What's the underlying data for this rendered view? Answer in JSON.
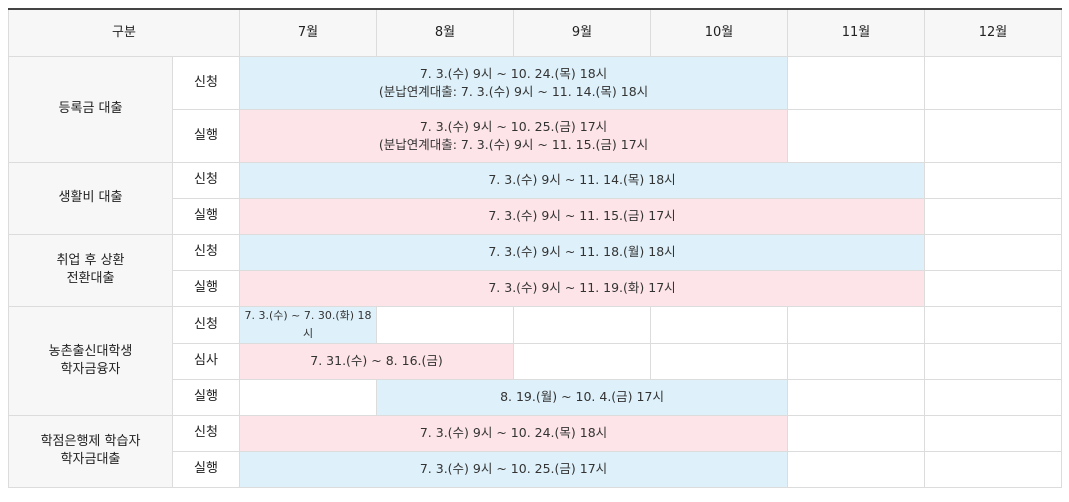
{
  "header": {
    "category": "구분",
    "months": [
      "7월",
      "8월",
      "9월",
      "10월",
      "11월",
      "12월"
    ]
  },
  "rows": {
    "tuition": {
      "category": "등록금 대출",
      "apply_label": "신청",
      "apply_line1": "7. 3.(수) 9시 ~ 10. 24.(목) 18시",
      "apply_line2": "(분납연계대출: 7. 3.(수) 9시 ~ 11. 14.(목) 18시",
      "exec_label": "실행",
      "exec_line1": "7. 3.(수) 9시 ~ 10. 25.(금) 17시",
      "exec_line2": "(분납연계대출: 7. 3.(수) 9시 ~ 11. 15.(금) 17시"
    },
    "living": {
      "category": "생활비 대출",
      "apply_label": "신청",
      "apply": "7. 3.(수) 9시 ~ 11. 14.(목) 18시",
      "exec_label": "실행",
      "exec": "7. 3.(수) 9시 ~ 11. 15.(금) 17시"
    },
    "employment": {
      "category_line1": "취업 후 상환",
      "category_line2": "전환대출",
      "apply_label": "신청",
      "apply": "7. 3.(수) 9시 ~ 11. 18.(월) 18시",
      "exec_label": "실행",
      "exec": "7. 3.(수) 9시 ~ 11. 19.(화) 17시"
    },
    "rural": {
      "category_line1": "농촌출신대학생",
      "category_line2": "학자금융자",
      "apply_label": "신청",
      "apply": "7. 3.(수) ~ 7. 30.(화) 18시",
      "review_label": "심사",
      "review": "7. 31.(수) ~ 8. 16.(금)",
      "exec_label": "실행",
      "exec": "8. 19.(월) ~ 10. 4.(금) 17시"
    },
    "credit_bank": {
      "category_line1": "학점은행제 학습자",
      "category_line2": "학자금대출",
      "apply_label": "신청",
      "apply": "7. 3.(수) 9시 ~ 10. 24.(목) 18시",
      "exec_label": "실행",
      "exec": "7. 3.(수) 9시 ~ 10. 25.(금) 17시"
    }
  },
  "colors": {
    "apply_bg": "#def1fa",
    "exec_bg": "#fde4e8",
    "header_bg": "#f7f7f7"
  }
}
